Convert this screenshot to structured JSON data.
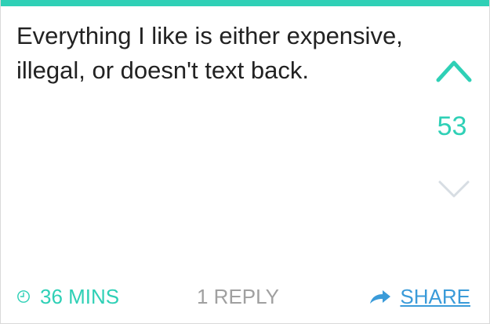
{
  "post": {
    "message": "Everything I like is either expensive, illegal, or doesn't text back.",
    "score": "53",
    "time_ago": "36 MINS",
    "replies": "1 REPLY",
    "share_label": "SHARE"
  },
  "colors": {
    "accent_teal": "#2fd0b6",
    "share_blue": "#3a9bd9",
    "muted_gray": "#a0a0a0"
  },
  "icons": {
    "upvote": "chevron-up-icon",
    "downvote": "chevron-down-icon",
    "clock": "clock-icon",
    "share": "share-arrow-icon"
  }
}
